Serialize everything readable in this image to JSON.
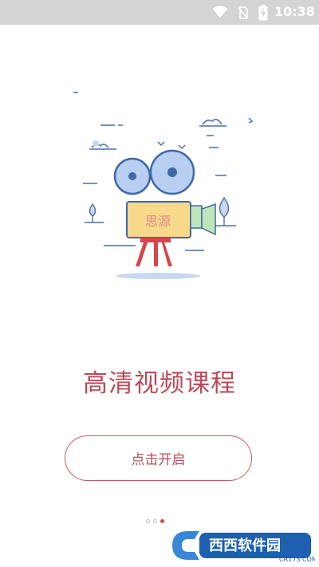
{
  "status_bar": {
    "time": "10:38",
    "icons": [
      "wifi-icon",
      "no-sim-icon",
      "battery-charging-icon"
    ]
  },
  "illustration": {
    "camera_label": "思源",
    "icon": "film-camera-icon"
  },
  "headline": "高清视频课程",
  "start_button": {
    "label": "点击开启"
  },
  "pager": {
    "total": 3,
    "current": 3
  },
  "watermark": {
    "brand": "西西软件园",
    "domain": "CR173.COM"
  },
  "colors": {
    "accent": "#b94b55",
    "status_bar": "#d4d4d4",
    "lens_blue": "#b8cff2"
  }
}
